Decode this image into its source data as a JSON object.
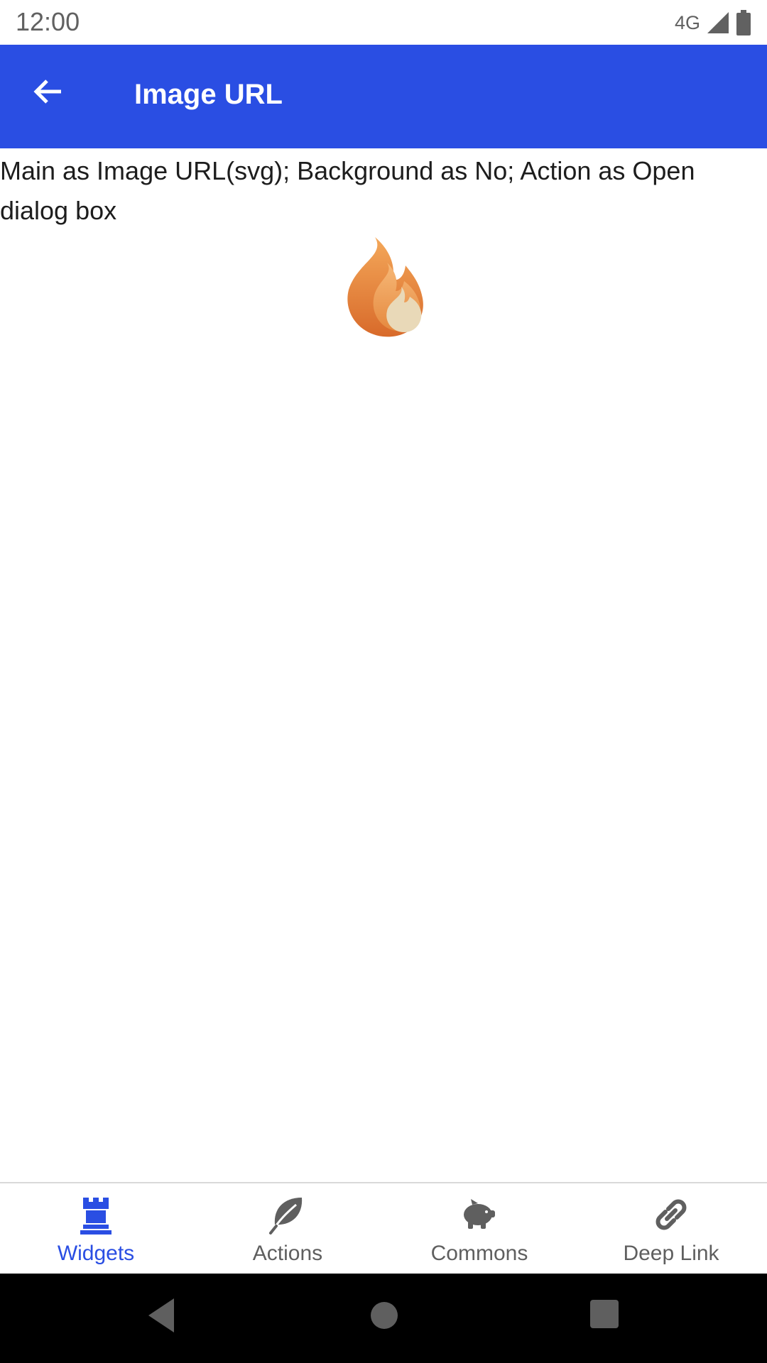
{
  "status_bar": {
    "time": "12:00",
    "network": "4G"
  },
  "app_bar": {
    "title": "Image URL",
    "back_icon": "arrow-left-icon"
  },
  "content": {
    "description": "Main as Image URL(svg); Background as No; Action as Open dialog box",
    "image_icon": "fire-icon"
  },
  "bottom_nav": {
    "items": [
      {
        "label": "Widgets",
        "icon": "castle-rook-icon",
        "active": true
      },
      {
        "label": "Actions",
        "icon": "leaf-icon",
        "active": false
      },
      {
        "label": "Commons",
        "icon": "piggy-bank-icon",
        "active": false
      },
      {
        "label": "Deep Link",
        "icon": "link-icon",
        "active": false
      }
    ]
  },
  "colors": {
    "accent": "#2a4ee3",
    "nav_inactive": "#5f5f5f",
    "system_nav_bg": "#000000"
  }
}
